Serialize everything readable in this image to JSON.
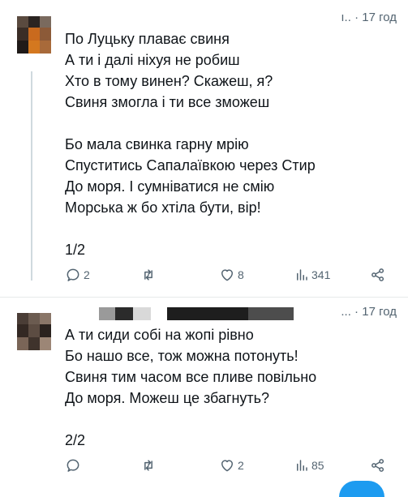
{
  "posts": [
    {
      "time_separator": "·",
      "time": "17 год",
      "name_fragment": "ı..",
      "lines": [
        "По Луцьку плаває свиня",
        "А ти і далі ніхуя не робиш",
        "Хто в тому винен? Скажеш, я?",
        "Свиня змогла і ти все зможеш",
        "Бо мала свинка гарну мрію",
        "Спуститись Сапалаївкою через Стир",
        "До моря. І сумніватися не смію",
        "Морська ж бо хтіла бути, вір!"
      ],
      "thread_counter": "1/2",
      "stats": {
        "replies": "2",
        "reposts": "",
        "likes": "8",
        "views": "341"
      }
    },
    {
      "time_separator": "... ·",
      "time": "17 год",
      "lines": [
        "А ти сиди собі на жопі рівно",
        "Бо нашо все, тож можна потонуть!",
        "Свиня тим часом все пливе повільно",
        "До моря. Можеш це збагнуть?"
      ],
      "thread_counter": "2/2",
      "stats": {
        "replies": "",
        "reposts": "",
        "likes": "2",
        "views": "85"
      }
    }
  ],
  "icons": [
    "reply-icon",
    "repost-icon",
    "like-icon",
    "views-icon",
    "share-icon"
  ],
  "colors": {
    "text": "#0f1419",
    "muted": "#536471",
    "divider": "#e7e9ea",
    "accent": "#1d9bf0"
  }
}
